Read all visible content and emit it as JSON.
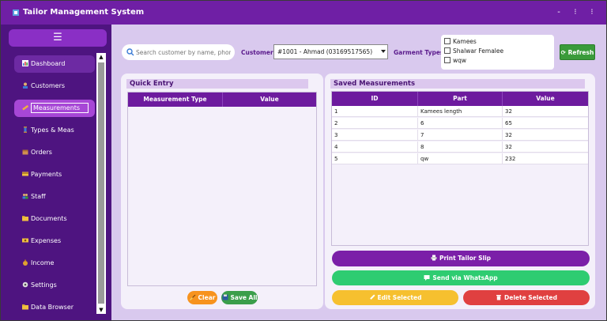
{
  "window": {
    "title": "Tailor Management System"
  },
  "window_controls": {
    "minimize": "-",
    "maximize": "⁝",
    "close": "⁝"
  },
  "sidebar": {
    "menu_glyph": "☰",
    "items": [
      {
        "label": "Dashboard",
        "icon": "chart-icon"
      },
      {
        "label": "Customers",
        "icon": "person-icon"
      },
      {
        "label": "Measurements",
        "icon": "ruler-icon"
      },
      {
        "label": "Types & Meas",
        "icon": "thread-icon"
      },
      {
        "label": "Orders",
        "icon": "box-icon"
      },
      {
        "label": "Payments",
        "icon": "card-icon"
      },
      {
        "label": "Staff",
        "icon": "people-icon"
      },
      {
        "label": "Documents",
        "icon": "folder-icon"
      },
      {
        "label": "Expenses",
        "icon": "money-icon"
      },
      {
        "label": "Income",
        "icon": "moneybag-icon"
      },
      {
        "label": "Settings",
        "icon": "gear-icon"
      },
      {
        "label": "Data Browser",
        "icon": "folder-icon"
      }
    ]
  },
  "toolbar": {
    "search_placeholder": "Search customer by name, phone,...",
    "customer_label": "Customer",
    "customer_value": "#1001 - Ahmad (03169517565)",
    "garment_types_label": "Garment Types",
    "garment_types": [
      "Kamees",
      "Shalwar Femalee",
      "wqw"
    ],
    "refresh_label": "Refresh"
  },
  "quick_entry": {
    "title": "Quick Entry",
    "columns": [
      "Measurement Type",
      "Value"
    ],
    "clear_label": "Clear",
    "save_label": "Save All"
  },
  "saved": {
    "title": "Saved Measurements",
    "columns": [
      "ID",
      "Part",
      "Value"
    ],
    "rows": [
      [
        "1",
        "Kamees length",
        "32"
      ],
      [
        "2",
        "6",
        "65"
      ],
      [
        "3",
        "7",
        "32"
      ],
      [
        "4",
        "8",
        "32"
      ],
      [
        "5",
        "qw",
        "232"
      ]
    ],
    "print_label": "Print Tailor Slip",
    "whatsapp_label": "Send via WhatsApp",
    "edit_label": "Edit Selected",
    "delete_label": "Delete Selected"
  },
  "colors": {
    "titlebar": "#6f1fa5",
    "sidebar": "#4e1480",
    "table_header": "#6d1b9e",
    "print": "#7b1fa8",
    "whatsapp": "#2ecc71",
    "edit": "#f6c02f",
    "delete": "#e04040",
    "clear": "#f7931e",
    "save": "#3b9e4b",
    "refresh": "#3a9b3a"
  }
}
